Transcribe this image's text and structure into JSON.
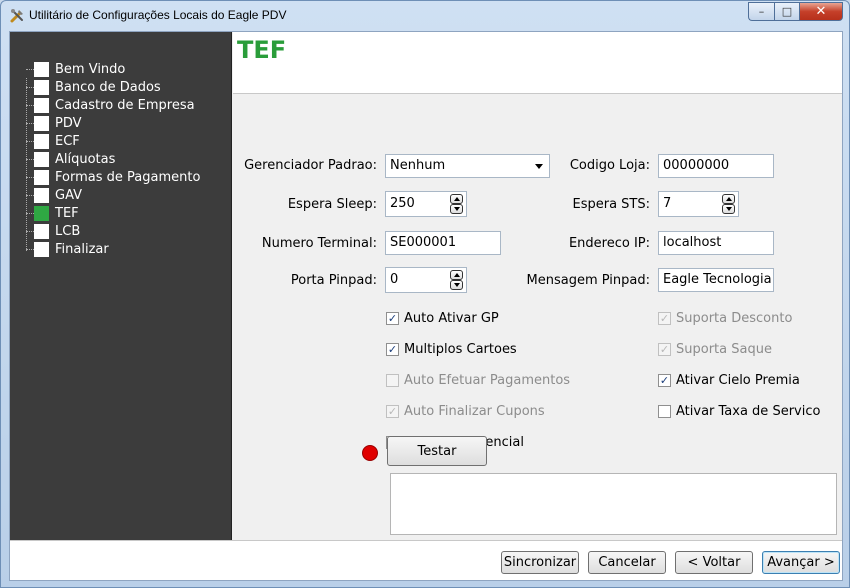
{
  "window": {
    "title": "Utilitário de Configurações Locais do Eagle PDV",
    "controls": {
      "minimize": "–",
      "maximize": "□",
      "close": "✕"
    }
  },
  "sidebar": {
    "items": [
      {
        "label": "Bem Vindo",
        "active": false
      },
      {
        "label": "Banco de Dados",
        "active": false
      },
      {
        "label": "Cadastro de Empresa",
        "active": false
      },
      {
        "label": "PDV",
        "active": false
      },
      {
        "label": "ECF",
        "active": false
      },
      {
        "label": "Alíquotas",
        "active": false
      },
      {
        "label": "Formas de Pagamento",
        "active": false
      },
      {
        "label": "GAV",
        "active": false
      },
      {
        "label": "TEF",
        "active": true
      },
      {
        "label": "LCB",
        "active": false
      },
      {
        "label": "Finalizar",
        "active": false
      }
    ]
  },
  "page": {
    "title": "TEF"
  },
  "form": {
    "gerenciador": {
      "label": "Gerenciador Padrao:",
      "value": "Nenhum"
    },
    "codigo_loja": {
      "label": "Codigo Loja:",
      "value": "00000000"
    },
    "espera_sleep": {
      "label": "Espera Sleep:",
      "value": "250"
    },
    "espera_sts": {
      "label": "Espera STS:",
      "value": "7"
    },
    "numero_terminal": {
      "label": "Numero Terminal:",
      "value": "SE000001"
    },
    "endereco_ip": {
      "label": "Endereco IP:",
      "value": "localhost"
    },
    "porta_pinpad": {
      "label": "Porta Pinpad:",
      "value": "0"
    },
    "mensagem_pinpad": {
      "label": "Mensagem Pinpad:",
      "value": "Eagle Tecnologia"
    }
  },
  "options": {
    "auto_ativar_gp": {
      "label": "Auto Ativar GP",
      "mark": "✓"
    },
    "multiplos_cartoes": {
      "label": "Multiplos Cartoes",
      "mark": "✓"
    },
    "auto_efetuar": {
      "label": "Auto Efetuar Pagamentos",
      "mark": ""
    },
    "auto_finalizar": {
      "label": "Auto Finalizar Cupons",
      "mark": "✓"
    },
    "chq_gerencial": {
      "label": "CHQ Em Gerencial",
      "mark": "✓"
    },
    "suporta_desconto": {
      "label": "Suporta Desconto",
      "mark": "✓"
    },
    "suporta_saque": {
      "label": "Suporta Saque",
      "mark": "✓"
    },
    "ativar_cielo": {
      "label": "Ativar Cielo Premia",
      "mark": "✓"
    },
    "ativar_taxa": {
      "label": "Ativar Taxa de Servico",
      "mark": ""
    }
  },
  "test": {
    "button_label": "Testar",
    "status_color": "#e00000"
  },
  "footer": {
    "sincronizar": "Sincronizar",
    "cancelar": "Cancelar",
    "voltar": "< Voltar",
    "avancar": "Avançar >"
  },
  "colors": {
    "accent": "#2a9d3a",
    "sidebar_bg": "#3c3c3c",
    "active_item": "#2fa843"
  }
}
